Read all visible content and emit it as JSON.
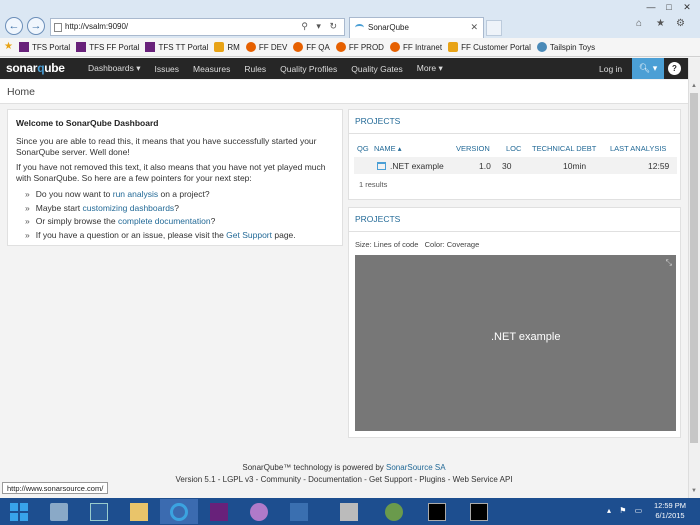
{
  "browser": {
    "url": "http://vsalm:9090/",
    "tab_title": "SonarQube",
    "tab_close": "✕",
    "back": "←",
    "forward": "→",
    "addr_tools": "⚲ ▾ ↻",
    "home_icon": "⌂",
    "fav_icon": "★",
    "settings_icon": "⚙",
    "win_min": "—",
    "win_max": "□",
    "win_close": "✕",
    "favorites": [
      {
        "label": "TFS Portal",
        "icon": "vs"
      },
      {
        "label": "TFS FF Portal",
        "icon": "vs"
      },
      {
        "label": "TFS TT Portal",
        "icon": "vs"
      },
      {
        "label": "RM",
        "icon": "ie"
      },
      {
        "label": "FF DEV",
        "icon": "ff"
      },
      {
        "label": "FF QA",
        "icon": "ff"
      },
      {
        "label": "FF PROD",
        "icon": "ff"
      },
      {
        "label": "FF Intranet",
        "icon": "ff"
      },
      {
        "label": "FF Customer Portal",
        "icon": "ie"
      },
      {
        "label": "Tailspin Toys",
        "icon": "ts"
      }
    ]
  },
  "nav": {
    "logo_a": "sonar",
    "logo_b": "q",
    "logo_c": "ube",
    "items": [
      "Dashboards ▾",
      "Issues",
      "Measures",
      "Rules",
      "Quality Profiles",
      "Quality Gates",
      "More ▾"
    ],
    "login": "Log in",
    "search": "🔍︎ ▾",
    "help": "?"
  },
  "page": {
    "title": "Home"
  },
  "welcome": {
    "heading": "Welcome to SonarQube Dashboard",
    "para1": "Since you are able to read this, it means that you have successfully started your SonarQube server. Well done!",
    "para2": "If you have not removed this text, it also means that you have not yet played much with SonarQube. So here are a few pointers for your next step:",
    "b1_pre": "Do you now want to ",
    "b1_link": "run analysis",
    "b1_post": " on a project?",
    "b2_pre": "Maybe start ",
    "b2_link": "customizing dashboards",
    "b2_post": "?",
    "b3_pre": "Or simply browse the ",
    "b3_link": "complete documentation",
    "b3_post": "?",
    "b4_pre": "If you have a question or an issue, please visit the ",
    "b4_link": "Get Support",
    "b4_post": " page."
  },
  "projects_table": {
    "title": "PROJECTS",
    "headers": [
      "QG",
      "NAME ▴",
      "VERSION",
      "LOC",
      "TECHNICAL DEBT",
      "LAST ANALYSIS"
    ],
    "row": {
      "name": ".NET example",
      "version": "1.0",
      "loc": "30",
      "debt": "10min",
      "last": "12:59"
    },
    "results": "1 results"
  },
  "projects_treemap": {
    "title": "PROJECTS",
    "size_label": "Size: Lines of code",
    "color_label": "Color: Coverage",
    "tile_label": ".NET example",
    "expand": "⤡"
  },
  "footer": {
    "line1_pre": "SonarQube™ technology is powered by ",
    "line1_link": "SonarSource SA",
    "line2": "Version 5.1 - LGPL v3 - Community - Documentation - Get Support - Plugins - Web Service API"
  },
  "status_tip": "http://www.sonarsource.com/",
  "taskbar": {
    "tray": "▴ ⚑ ▭",
    "time": "12:59 PM",
    "date": "6/1/2015"
  },
  "colors": {
    "accent": "#4b9fd5",
    "link": "#236a97",
    "nav_bg": "#262626",
    "treemap": "#777777",
    "taskbar": "#1d4e8f"
  }
}
